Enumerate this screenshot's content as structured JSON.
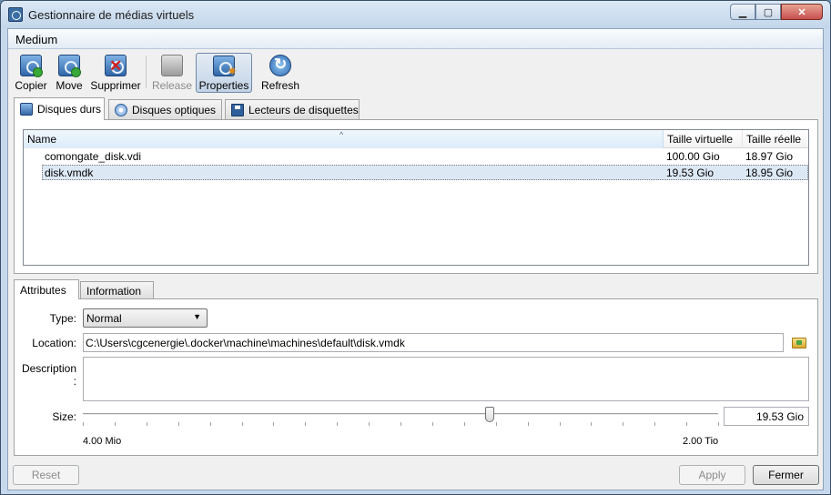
{
  "window": {
    "title": "Gestionnaire de médias virtuels"
  },
  "menu": {
    "medium": "Medium"
  },
  "toolbar": {
    "copy": "Copier",
    "move": "Move",
    "remove": "Supprimer",
    "release": "Release",
    "properties": "Properties",
    "refresh": "Refresh"
  },
  "tabs": {
    "hard_disks": "Disques durs",
    "optical_disks": "Disques optiques",
    "floppy_disks": "Lecteurs de disquettes"
  },
  "list": {
    "columns": {
      "name": "Name",
      "virtual_size": "Taille virtuelle",
      "actual_size": "Taille réelle"
    },
    "rows": [
      {
        "name": "comongate_disk.vdi",
        "virtual_size": "100.00 Gio",
        "actual_size": "18.97 Gio"
      },
      {
        "name": "disk.vmdk",
        "virtual_size": "19.53 Gio",
        "actual_size": "18.95 Gio",
        "selected": true
      }
    ]
  },
  "details": {
    "tabs": {
      "attributes": "Attributes",
      "information": "Information"
    },
    "type_label": "Type:",
    "type_value": "Normal",
    "location_label": "Location:",
    "location_value": "C:\\Users\\cgcenergie\\.docker\\machine\\machines\\default\\disk.vmdk",
    "description_label": "Description :",
    "size_label": "Size:",
    "size_min": "4.00 Mio",
    "size_max": "2.00 Tio",
    "size_value": "19.53 Gio",
    "slider_position": 0.64
  },
  "buttons": {
    "reset": "Reset",
    "apply": "Apply",
    "close": "Fermer"
  }
}
